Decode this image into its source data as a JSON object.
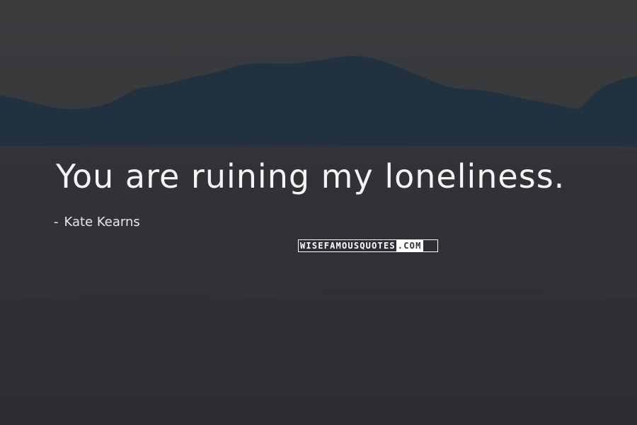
{
  "quote": {
    "text": "You are ruining my loneliness."
  },
  "author": {
    "dash": "-",
    "name": "Kate Kearns"
  },
  "watermark": {
    "main": "WISEFAMOUSQUOTES",
    "suffix": ".COM"
  },
  "colors": {
    "sky": "#3a3b3d",
    "mountains": "#233142",
    "ground": "#2f3034",
    "text": "#f4f4f4"
  }
}
